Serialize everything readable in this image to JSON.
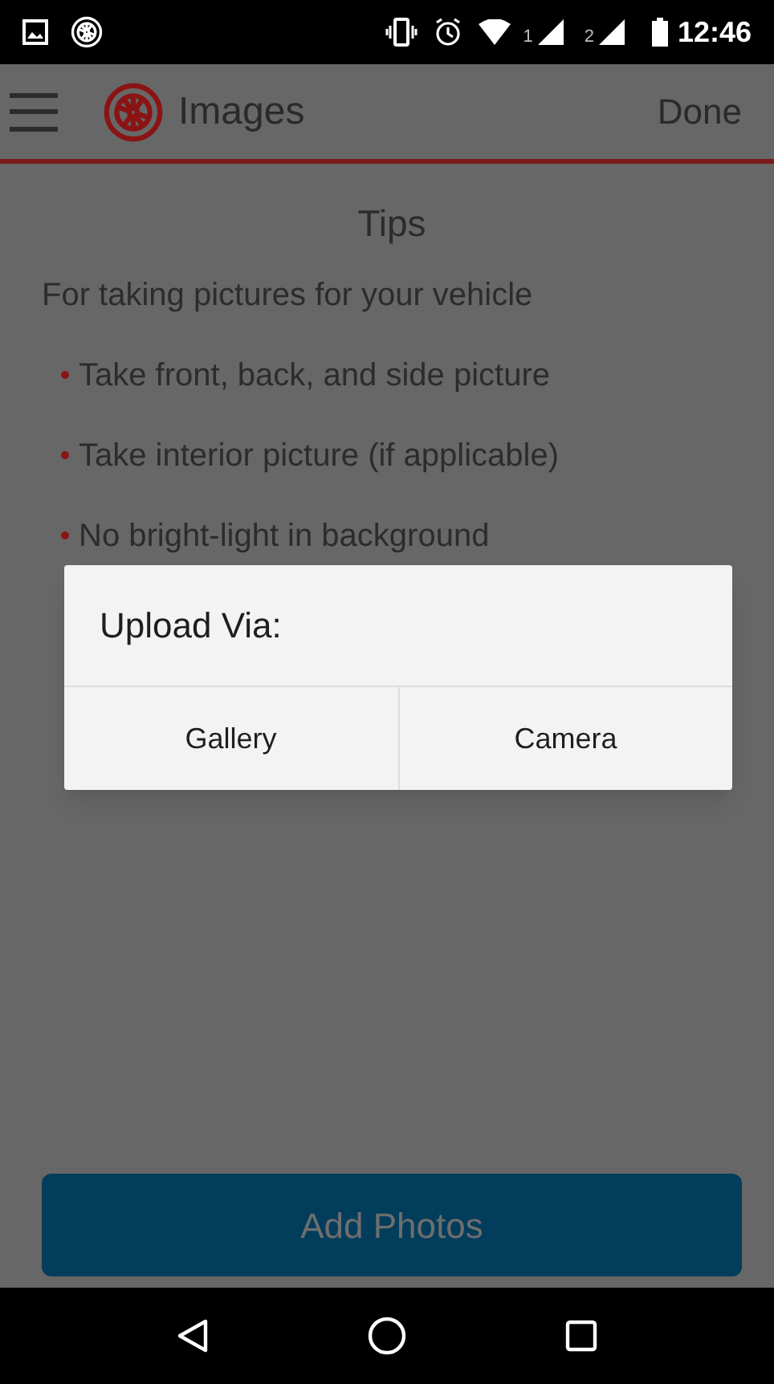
{
  "status_bar": {
    "sim_labels": [
      "1",
      "2"
    ],
    "time": "12:46"
  },
  "app_bar": {
    "title": "Images",
    "action": "Done"
  },
  "tips": {
    "title": "Tips",
    "intro": "For taking pictures for your vehicle",
    "items": [
      "Take front, back, and side picture",
      "Take interior picture (if applicable)",
      "No bright-light in background"
    ]
  },
  "dialog": {
    "title": "Upload Via:",
    "buttons": [
      "Gallery",
      "Camera"
    ]
  },
  "primary_button": {
    "label": "Add Photos",
    "disabled": true
  }
}
